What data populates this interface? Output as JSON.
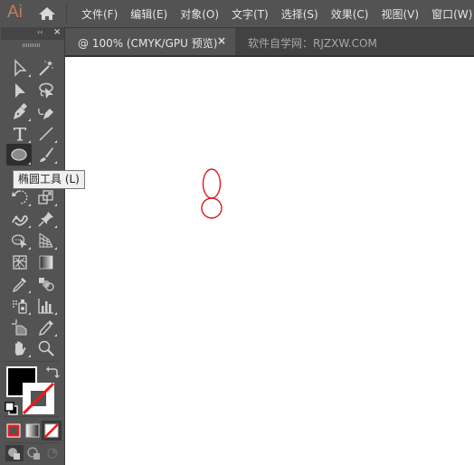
{
  "app": {
    "logo": "Ai",
    "home_icon": "home-icon"
  },
  "menubar": {
    "items": [
      "文件(F)",
      "编辑(E)",
      "对象(O)",
      "文字(T)",
      "选择(S)",
      "效果(C)",
      "视图(V)",
      "窗口(W)"
    ]
  },
  "tabs": {
    "active": {
      "label": "@ 100% (CMYK/GPU 预览)",
      "close": "×"
    },
    "inactive": {
      "label": "软件自学网：RJZXW.COM"
    }
  },
  "toolbox": {
    "collapse": "‹‹",
    "close": "×",
    "tools": [
      "selection-tool",
      "magic-wand-tool",
      "direct-selection-tool",
      "lasso-tool",
      "pen-tool",
      "curvature-tool",
      "type-tool",
      "line-segment-tool",
      "ellipse-tool",
      "paintbrush-tool",
      "shaper-tool",
      "eraser-tool",
      "rotate-tool",
      "scale-tool",
      "warp-tool",
      "puppet-warp-tool",
      "shape-builder-tool",
      "perspective-grid-tool",
      "mesh-tool",
      "gradient-tool",
      "eyedropper-tool",
      "blend-tool",
      "symbol-sprayer-tool",
      "column-graph-tool",
      "artboard-tool",
      "slice-tool",
      "hand-tool",
      "zoom-tool"
    ],
    "selected_tool": "ellipse-tool",
    "fill_color": "#000000",
    "stroke": "none"
  },
  "tooltip": {
    "text": "椭圆工具 (L)"
  },
  "canvas": {
    "shape_stroke_color": "#e0161c",
    "shapes": [
      "ellipse-tall",
      "circle-bottom"
    ]
  },
  "colors": {
    "accent_red": "#e0161c",
    "panel": "#535353",
    "tabbar": "#424242"
  }
}
